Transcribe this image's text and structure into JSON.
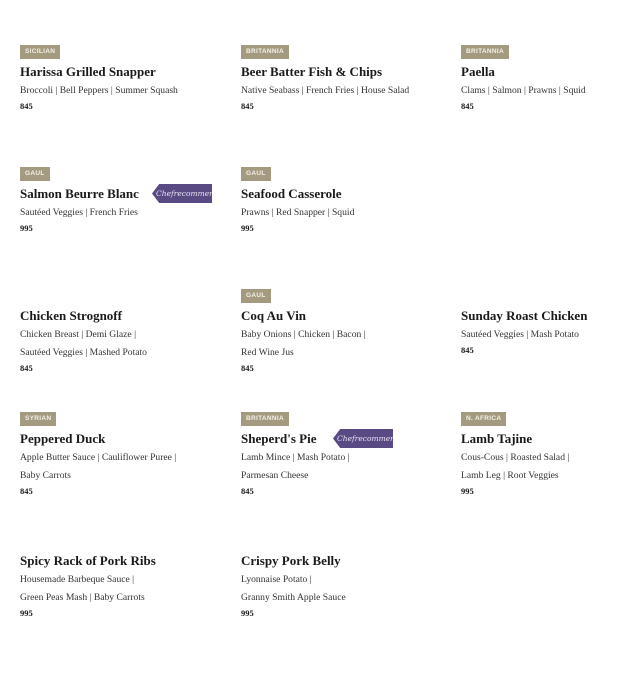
{
  "menu": {
    "items": [
      {
        "tag": "Sicilian",
        "name": "Harissa Grilled Snapper",
        "desc": [
          "Broccoli | Bell Peppers | Summer Squash"
        ],
        "price": "845",
        "badge": ""
      },
      {
        "tag": "Britannia",
        "name": "Beer Batter Fish & Chips",
        "desc": [
          "Native Seabass | French Fries | House Salad"
        ],
        "price": "845",
        "badge": ""
      },
      {
        "tag": "Britannia",
        "name": "Paella",
        "desc": [
          "Clams | Salmon | Prawns | Squid"
        ],
        "price": "845",
        "badge": ""
      },
      {
        "tag": "Gaul",
        "name": "Salmon Beurre Blanc",
        "desc": [
          "Sautéed Veggies | French Fries"
        ],
        "price": "995",
        "badge": "Chefrecommends"
      },
      {
        "tag": "Gaul",
        "name": "Seafood Casserole",
        "desc": [
          "Prawns | Red Snapper | Squid"
        ],
        "price": "995",
        "badge": ""
      },
      {
        "tag": "",
        "name": "Chicken Strognoff",
        "desc": [
          "Chicken Breast | Demi Glaze |",
          "Sautéed Veggies | Mashed Potato"
        ],
        "price": "845",
        "badge": ""
      },
      {
        "tag": "Gaul",
        "name": "Coq Au Vin",
        "desc": [
          "Baby Onions | Chicken | Bacon |",
          "Red Wine Jus"
        ],
        "price": "845",
        "badge": ""
      },
      {
        "tag": "",
        "name": "Sunday Roast Chicken",
        "desc": [
          "Sautéed Veggies | Mash Potato"
        ],
        "price": "845",
        "badge": ""
      },
      {
        "tag": "Syrian",
        "name": "Peppered Duck",
        "desc": [
          "Apple Butter Sauce | Cauliflower Puree |",
          "Baby Carrots"
        ],
        "price": "845",
        "badge": ""
      },
      {
        "tag": "Britannia",
        "name": "Sheperd's Pie",
        "desc": [
          "Lamb Mince | Mash Potato |",
          "Parmesan Cheese"
        ],
        "price": "845",
        "badge": "Chefrecommends"
      },
      {
        "tag": "N. Africa",
        "name": "Lamb Tajine",
        "desc": [
          "Cous-Cous | Roasted Salad |",
          "Lamb Leg | Root Veggies"
        ],
        "price": "995",
        "badge": ""
      },
      {
        "tag": "",
        "name": "Spicy Rack of Pork Ribs",
        "desc": [
          "Housemade Barbeque Sauce |",
          "Green Peas Mash | Baby Carrots"
        ],
        "price": "995",
        "badge": ""
      },
      {
        "tag": "",
        "name": "Crispy Pork Belly",
        "desc": [
          "Lyonnaise Potato |",
          "Granny Smith Apple Sauce"
        ],
        "price": "995",
        "badge": ""
      }
    ]
  }
}
